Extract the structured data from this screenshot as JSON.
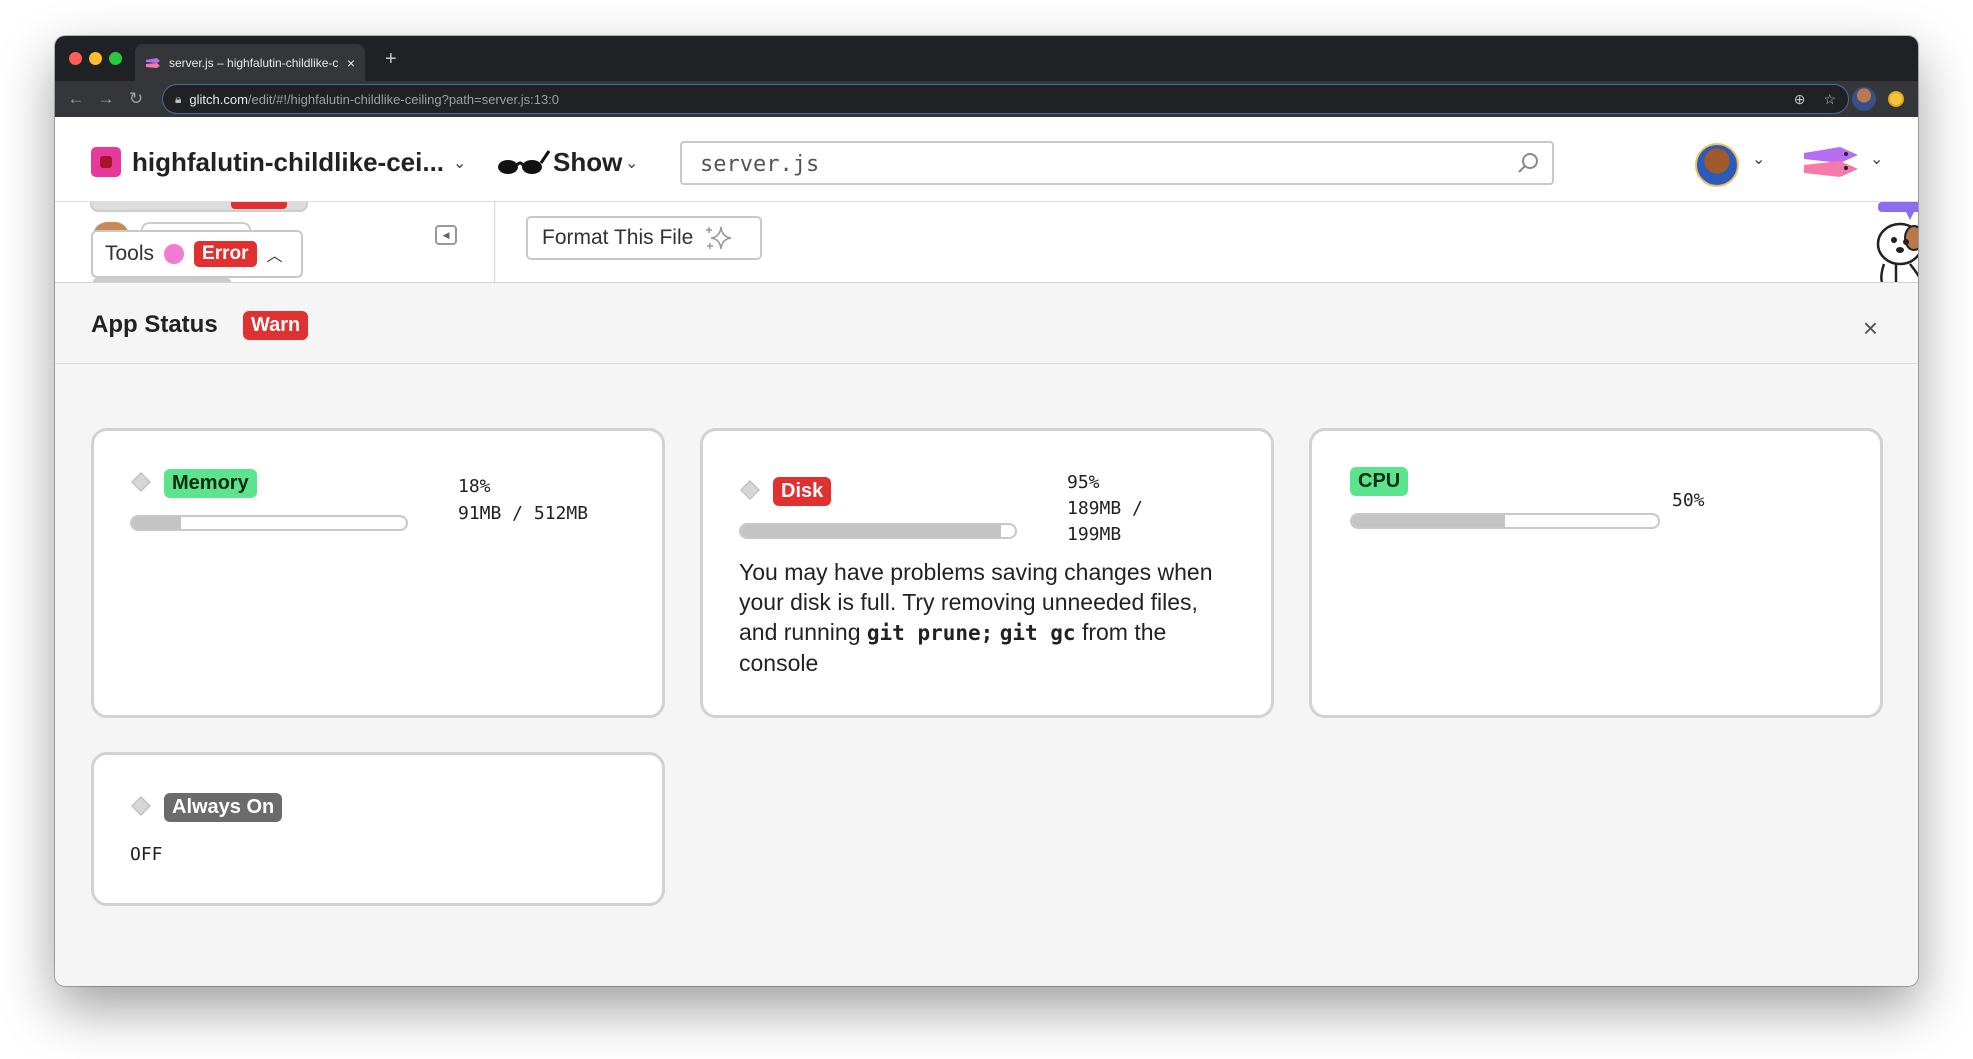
{
  "browser": {
    "tab_title": "server.js – highfalutin-childlike-c",
    "tab_close": "×",
    "new_tab": "+",
    "url_domain": "glitch.com",
    "url_path": "/edit/#!/highfalutin-childlike-ceiling?path=server.js:13:0"
  },
  "header": {
    "project_name": "highfalutin-childlike-cei...",
    "show_label": "Show",
    "search_value": "server.js"
  },
  "sidebar": {
    "tools_label": "Tools",
    "tools_status": "Error"
  },
  "editor": {
    "format_label": "Format This File"
  },
  "status": {
    "title": "App Status",
    "badge": "Warn",
    "close": "×",
    "memory": {
      "label": "Memory",
      "percent": "18%",
      "usage": "91MB / 512MB",
      "fill": 0.18
    },
    "disk": {
      "label": "Disk",
      "percent": "95%",
      "usage_line1": "189MB /",
      "usage_line2": "199MB",
      "fill": 0.95,
      "msg_text": "You may have problems saving changes when your disk is full. Try removing unneeded files, and running",
      "msg_code1": "git prune;",
      "msg_code2": "git gc",
      "msg_tail": "from the console"
    },
    "cpu": {
      "label": "CPU",
      "percent": "50%",
      "fill": 0.5
    },
    "always_on": {
      "label": "Always On",
      "value": "OFF"
    }
  },
  "colors": {
    "error_red": "#e03030",
    "ok_green": "#5ce38d",
    "glitch_pink": "#e6399b"
  }
}
